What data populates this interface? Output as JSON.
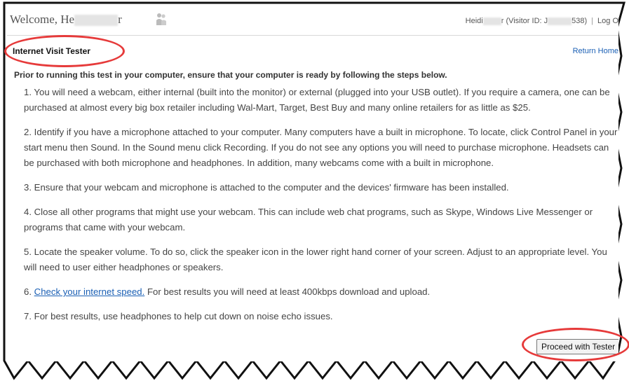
{
  "header": {
    "welcome_prefix": "Welcome, He",
    "welcome_suffix": "r",
    "user_name_prefix": "Heidi",
    "visitor_id_prefix": "r (Visitor ID: J",
    "visitor_id_suffix": "538)",
    "separator": "|",
    "logout_label": "Log O"
  },
  "page": {
    "title": "Internet Visit Tester",
    "return_home": "Return Home",
    "intro": "Prior to running this test in your computer, ensure that your computer is ready by following the steps below."
  },
  "steps": [
    "1. You will need a webcam, either internal (built into the monitor) or external (plugged into your USB outlet). If you require a camera, one can be purchased at almost every big box retailer including Wal-Mart, Target, Best Buy and many online retailers for as little as $25.",
    "2. Identify if you have a microphone attached to your computer. Many computers have a built in microphone. To locate, click Control Panel in your start menu then Sound. In the Sound menu click Recording. If you do not see any options you will need to purchase microphone. Headsets can be purchased with both microphone and headphones. In addition, many webcams come with a built in microphone.",
    "3. Ensure that your webcam and microphone is attached to the computer and the devices' firmware has been installed.",
    "4. Close all other programs that might use your webcam. This can include web chat programs, such as Skype, Windows Live Messenger or programs that came with your webcam.",
    "5. Locate the speaker volume. To do so, click the speaker icon in the lower right hand corner of your screen. Adjust to an appropriate level. You will need to user either headphones or speakers."
  ],
  "step6": {
    "prefix": "6. ",
    "link": "Check your internet speed.",
    "suffix": " For best results you will need at least 400kbps download and upload."
  },
  "step7": "7. For best results, use headphones to help cut down on noise echo issues.",
  "actions": {
    "proceed_label": "Proceed with Tester"
  },
  "colors": {
    "link": "#1a5fb4",
    "highlight_ring": "#e63a3a"
  },
  "icons": {
    "user": "users-icon"
  }
}
